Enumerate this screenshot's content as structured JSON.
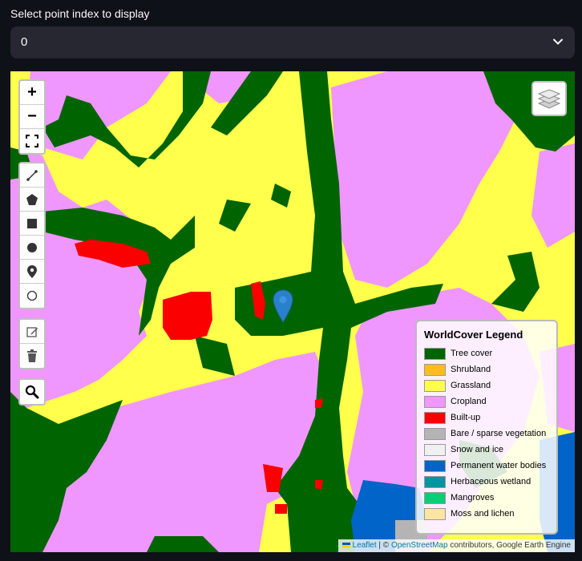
{
  "selector": {
    "label": "Select point index to display",
    "value": "0"
  },
  "map": {
    "zoom_in": "+",
    "zoom_out": "−",
    "draw_tools": [
      "polyline",
      "polygon",
      "rectangle",
      "circle",
      "marker",
      "circlemarker"
    ],
    "edit_tools": [
      "edit",
      "delete"
    ]
  },
  "legend": {
    "title": "WorldCover Legend",
    "items": [
      {
        "label": "Tree cover",
        "color": "#006400"
      },
      {
        "label": "Shrubland",
        "color": "#ffbb22"
      },
      {
        "label": "Grassland",
        "color": "#ffff4c"
      },
      {
        "label": "Cropland",
        "color": "#f096ff"
      },
      {
        "label": "Built-up",
        "color": "#fa0000"
      },
      {
        "label": "Bare / sparse vegetation",
        "color": "#b4b4b4"
      },
      {
        "label": "Snow and ice",
        "color": "#f0f0f0"
      },
      {
        "label": "Permanent water bodies",
        "color": "#0064c8"
      },
      {
        "label": "Herbaceous wetland",
        "color": "#0096a0"
      },
      {
        "label": "Mangroves",
        "color": "#00cf75"
      },
      {
        "label": "Moss and lichen",
        "color": "#fae6a0"
      }
    ]
  },
  "attribution": {
    "leaflet": "Leaflet",
    "separator": " | © ",
    "osm": "OpenStreetMap",
    "rest": " contributors, Google Earth Engine"
  }
}
